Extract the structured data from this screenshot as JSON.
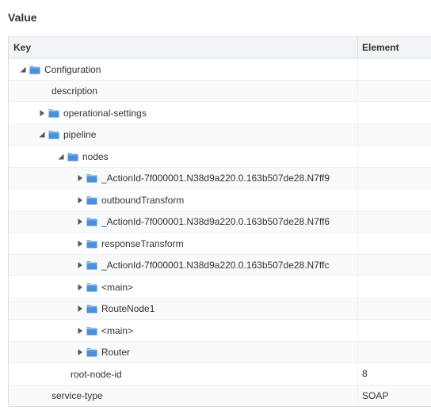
{
  "section": {
    "title": "Value"
  },
  "columns": {
    "key": "Key",
    "element": "Element"
  },
  "rows": [
    {
      "label": "Configuration",
      "value": "",
      "depth": 0,
      "toggle": "expanded",
      "folder": true
    },
    {
      "label": "description",
      "value": "",
      "depth": 1,
      "toggle": "none",
      "folder": false
    },
    {
      "label": "operational-settings",
      "value": "",
      "depth": 1,
      "toggle": "collapsed",
      "folder": true
    },
    {
      "label": "pipeline",
      "value": "",
      "depth": 1,
      "toggle": "expanded",
      "folder": true
    },
    {
      "label": "nodes",
      "value": "",
      "depth": 2,
      "toggle": "expanded",
      "folder": true
    },
    {
      "label": "_ActionId-7f000001.N38d9a220.0.163b507de28.N7ff9",
      "value": "",
      "depth": 3,
      "toggle": "collapsed",
      "folder": true
    },
    {
      "label": "outboundTransform",
      "value": "",
      "depth": 3,
      "toggle": "collapsed",
      "folder": true
    },
    {
      "label": "_ActionId-7f000001.N38d9a220.0.163b507de28.N7ff6",
      "value": "",
      "depth": 3,
      "toggle": "collapsed",
      "folder": true
    },
    {
      "label": "responseTransform",
      "value": "",
      "depth": 3,
      "toggle": "collapsed",
      "folder": true
    },
    {
      "label": "_ActionId-7f000001.N38d9a220.0.163b507de28.N7ffc",
      "value": "",
      "depth": 3,
      "toggle": "collapsed",
      "folder": true
    },
    {
      "label": "<main>",
      "value": "",
      "depth": 3,
      "toggle": "collapsed",
      "folder": true
    },
    {
      "label": "RouteNode1",
      "value": "",
      "depth": 3,
      "toggle": "collapsed",
      "folder": true
    },
    {
      "label": "<main>",
      "value": "",
      "depth": 3,
      "toggle": "collapsed",
      "folder": true
    },
    {
      "label": "Router",
      "value": "",
      "depth": 3,
      "toggle": "collapsed",
      "folder": true
    },
    {
      "label": "root-node-id",
      "value": "8",
      "depth": 2,
      "toggle": "none",
      "folder": false
    },
    {
      "label": "service-type",
      "value": "SOAP",
      "depth": 1,
      "toggle": "none",
      "folder": false
    }
  ],
  "icons": {
    "folder": "folder-icon",
    "expanded": "triangle-down-icon",
    "collapsed": "triangle-right-icon"
  },
  "colors": {
    "folder": "#4a90d9",
    "folderTab": "#6aa8e6",
    "triangle": "#555555"
  }
}
